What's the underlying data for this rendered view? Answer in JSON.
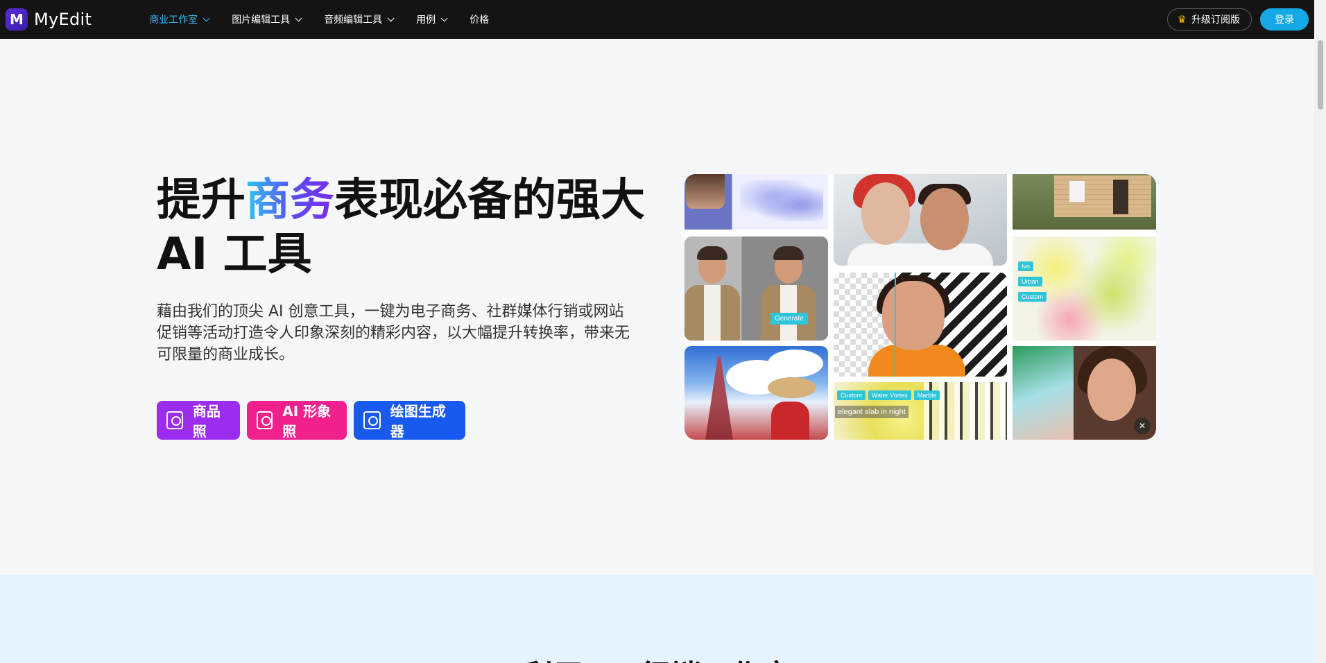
{
  "nav": {
    "logo_text": "MyEdit",
    "logo_mark": "M",
    "items": [
      {
        "label": "商业工作室",
        "active": true,
        "has_dropdown": true
      },
      {
        "label": "图片编辑工具",
        "active": false,
        "has_dropdown": true
      },
      {
        "label": "音频编辑工具",
        "active": false,
        "has_dropdown": true
      },
      {
        "label": "用例",
        "active": false,
        "has_dropdown": true
      },
      {
        "label": "价格",
        "active": false,
        "has_dropdown": false
      }
    ],
    "upgrade_label": "升级订阅版",
    "upgrade_icon": "crown-icon",
    "login_label": "登录"
  },
  "hero": {
    "title_pre": "提升",
    "title_highlight": "商务",
    "title_post": "表现必备的强大",
    "title_line2": "AI 工具",
    "description": "藉由我们的顶尖 AI 创意工具，一键为电子商务、社群媒体行销或网站促销等活动打造令人印象深刻的精彩内容，以大幅提升转换率，带来无可限量的商业成长。",
    "ctas": [
      {
        "label": "商品照",
        "icon": "product-photo-icon",
        "color": "#9b2cf0"
      },
      {
        "label": "AI 形象照",
        "icon": "portrait-icon",
        "color": "#f0208c"
      },
      {
        "label": "绘图生成器",
        "icon": "image-generator-icon",
        "color": "#1859f0"
      }
    ]
  },
  "mosaic": {
    "generate_tag": "Generate",
    "style_tags": [
      "Custom",
      "Water Vortex",
      "Marble"
    ],
    "prompt_text": "elegant slab in night",
    "side_tags": [
      "Ivo",
      "Urban",
      "Custom"
    ],
    "mute_icon": "mute-icon"
  },
  "section2": {
    "title": "利用 AI 行销工作室"
  },
  "colors": {
    "nav_bg": "#141414",
    "accent": "#14a9e6",
    "active_nav": "#35b8f2"
  }
}
